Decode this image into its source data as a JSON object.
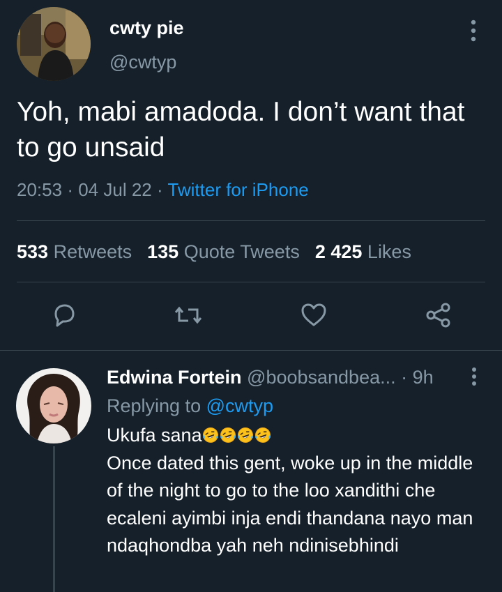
{
  "tweet": {
    "author_name": "cwty pie",
    "author_handle": "@cwtyp",
    "text": "Yoh, mabi amadoda. I don’t want that to go unsaid",
    "time": "20:53",
    "date": "04 Jul 22",
    "separator": "·",
    "source": "Twitter for iPhone"
  },
  "stats": {
    "retweets_count": "533",
    "retweets_label": "Retweets",
    "quotes_count": "135",
    "quotes_label": "Quote Tweets",
    "likes_count": "2 425",
    "likes_label": "Likes"
  },
  "actions": {
    "icons": [
      "reply-icon",
      "retweet-icon",
      "like-icon",
      "share-icon"
    ]
  },
  "reply": {
    "author_name": "Edwina Fortein",
    "author_handle": "@boobsandbea...",
    "separator": "·",
    "age": "9h",
    "replying_prefix": "Replying to",
    "replying_handle": "@cwtyp",
    "line1": "Ukufa sana",
    "emoji_count": 4,
    "text": "Once dated this gent, woke up in the middle of the night to go to the loo xandithi che ecaleni ayimbi inja endi thandana nayo man ndaqhondba yah neh ndinisebhindi"
  },
  "colors": {
    "background": "#15202b",
    "text": "#ffffff",
    "muted": "#8899a6",
    "link": "#1d9bf0",
    "divider": "#38444d"
  }
}
